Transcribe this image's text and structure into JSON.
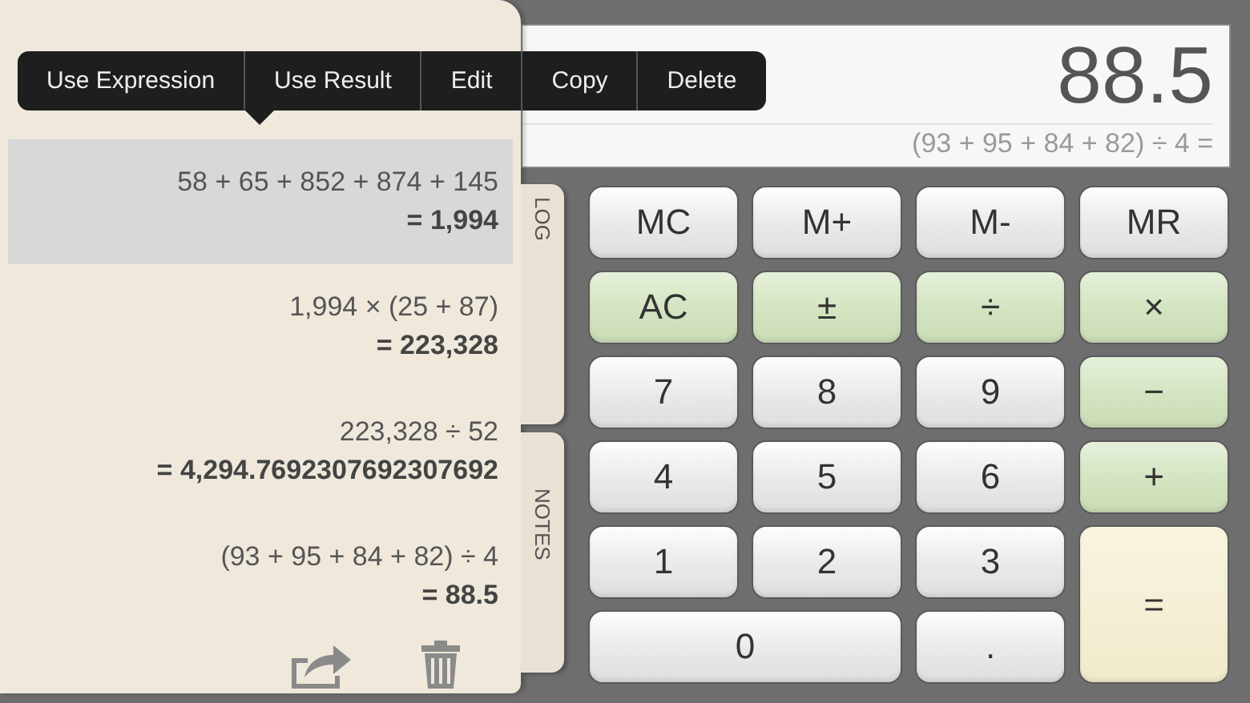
{
  "display": {
    "value": "88.5",
    "expression": "(93 + 95 + 84 + 82) ÷ 4 ="
  },
  "keypad": [
    {
      "label": "MC",
      "kind": "memory"
    },
    {
      "label": "M+",
      "kind": "memory"
    },
    {
      "label": "M-",
      "kind": "memory"
    },
    {
      "label": "MR",
      "kind": "memory"
    },
    {
      "label": "AC",
      "kind": "function"
    },
    {
      "label": "±",
      "kind": "function"
    },
    {
      "label": "÷",
      "kind": "operator"
    },
    {
      "label": "×",
      "kind": "operator"
    },
    {
      "label": "7",
      "kind": "digit"
    },
    {
      "label": "8",
      "kind": "digit"
    },
    {
      "label": "9",
      "kind": "digit"
    },
    {
      "label": "−",
      "kind": "operator"
    },
    {
      "label": "4",
      "kind": "digit"
    },
    {
      "label": "5",
      "kind": "digit"
    },
    {
      "label": "6",
      "kind": "digit"
    },
    {
      "label": "+",
      "kind": "operator"
    },
    {
      "label": "1",
      "kind": "digit"
    },
    {
      "label": "2",
      "kind": "digit"
    },
    {
      "label": "3",
      "kind": "digit"
    },
    {
      "label": "=",
      "kind": "equals"
    },
    {
      "label": "0",
      "kind": "wide-digit"
    },
    {
      "label": ".",
      "kind": "digit"
    }
  ],
  "log": {
    "entries": [
      {
        "expression": "58 + 65 + 852 + 874 + 145",
        "result": "= 1,994",
        "selected": true
      },
      {
        "expression": "1,994 × (25 + 87)",
        "result": "= 223,328",
        "selected": false
      },
      {
        "expression": "223,328 ÷ 52",
        "result": "= 4,294.7692307692307692",
        "selected": false
      },
      {
        "expression": "(93 + 95 + 84 + 82) ÷ 4",
        "result": "= 88.5",
        "selected": false
      }
    ]
  },
  "side_tabs": [
    "LOG",
    "NOTES"
  ],
  "context_menu": {
    "items": [
      "Use Expression",
      "Use Result",
      "Edit",
      "Copy",
      "Delete"
    ]
  }
}
